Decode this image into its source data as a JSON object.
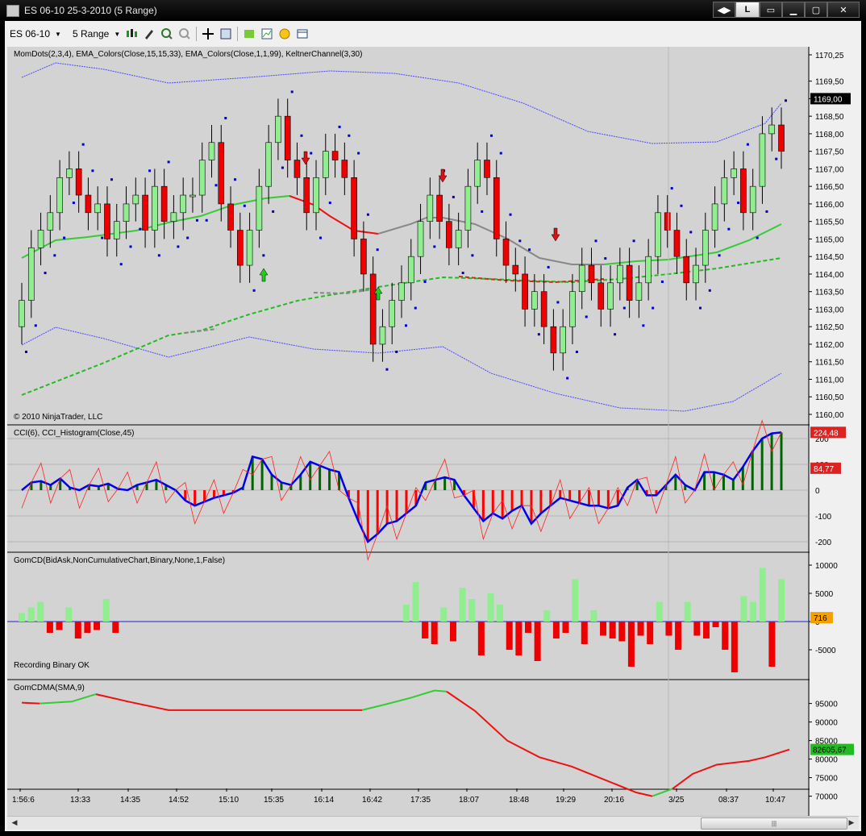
{
  "window": {
    "title": "ES 06-10  25-3-2010 (5 Range)",
    "lock_label": "L"
  },
  "toolbar": {
    "instrument": "ES 06-10",
    "period": "5 Range"
  },
  "panels": {
    "price": {
      "label": "MomDots(2,3,4), EMA_Colors(Close,15,15,33), EMA_Colors(Close,1,1,99), KeltnerChannel(3,30)",
      "copyright": "© 2010 NinjaTrader, LLC",
      "ticks": [
        "1170,25",
        "1169,50",
        "1169,00",
        "1168,50",
        "1168,00",
        "1167,50",
        "1167,00",
        "1166,50",
        "1166,00",
        "1165,50",
        "1165,00",
        "1164,50",
        "1164,00",
        "1163,50",
        "1163,00",
        "1162,50",
        "1162,00",
        "1161,50",
        "1161,00",
        "1160,50",
        "1160,00"
      ],
      "last_price": "1169,00"
    },
    "cci": {
      "label": "CCI(6), CCI_Histogram(Close,45)",
      "ticks": [
        "200",
        "100",
        "0",
        "-100",
        "-200"
      ],
      "badge_hi": "224,48",
      "badge_lo": "84,77"
    },
    "gomcd": {
      "label": "GomCD(BidAsk,NonCumulativeChart,Binary,None,1,False)",
      "status": "Recording Binary OK",
      "ticks": [
        "10000",
        "5000",
        "0",
        "-5000"
      ],
      "badge": "716"
    },
    "gomcdma": {
      "label": "GomCDMA(SMA,9)",
      "ticks": [
        "95000",
        "90000",
        "85000",
        "80000",
        "75000",
        "70000"
      ],
      "badge": "82605,67"
    }
  },
  "time_axis": [
    "1:56:6",
    "13:33",
    "14:35",
    "14:52",
    "15:10",
    "15:35",
    "16:14",
    "16:42",
    "17:35",
    "18:07",
    "18:48",
    "19:29",
    "20:16",
    "3/25",
    "08:37",
    "10:47"
  ],
  "colors": {
    "background": "#d3d3d3",
    "up_candle": "#90ee90",
    "down_candle": "#ee0000",
    "dots": "#0000cc",
    "keltner": "#4a4aff",
    "cci_line": "#0000ee",
    "hist_up": "#006400",
    "hist_down": "#ff0000"
  },
  "icons": [
    "bar-type-icon",
    "pencil-icon",
    "zoom-in-icon",
    "zoom-out-icon",
    "crosshair-icon",
    "properties-icon",
    "strategy-icon",
    "chart-trader-icon",
    "money-icon",
    "data-box-icon"
  ],
  "chart_data": {
    "type": "candlestick",
    "title": "ES 06-10 25-3-2010 (5 Range)",
    "ohlc_close_approx": [
      1163.25,
      1164.75,
      1165.25,
      1165.75,
      1166.75,
      1167.0,
      1166.25,
      1165.75,
      1166.0,
      1165.0,
      1165.5,
      1166.0,
      1166.25,
      1165.25,
      1166.5,
      1165.5,
      1165.75,
      1166.25,
      1166.25,
      1167.25,
      1167.75,
      1166.0,
      1165.25,
      1164.25,
      1165.25,
      1166.5,
      1167.75,
      1168.5,
      1167.25,
      1166.75,
      1165.75,
      1166.75,
      1167.5,
      1167.25,
      1166.75,
      1165.0,
      1164.0,
      1162.0,
      1162.5,
      1163.25,
      1163.75,
      1164.5,
      1165.5,
      1166.25,
      1165.5,
      1164.75,
      1165.25,
      1166.5,
      1167.25,
      1166.75,
      1165.0,
      1164.25,
      1164.0,
      1163.0,
      1163.5,
      1162.5,
      1161.75,
      1162.5,
      1163.5,
      1164.25,
      1163.75,
      1163.0,
      1163.75,
      1164.25,
      1163.25,
      1163.75,
      1164.5,
      1165.75,
      1165.25,
      1164.5,
      1163.75,
      1164.25,
      1165.25,
      1166.0,
      1166.75,
      1167.0,
      1165.75,
      1166.5,
      1168.0,
      1168.25,
      1167.5
    ]
  }
}
